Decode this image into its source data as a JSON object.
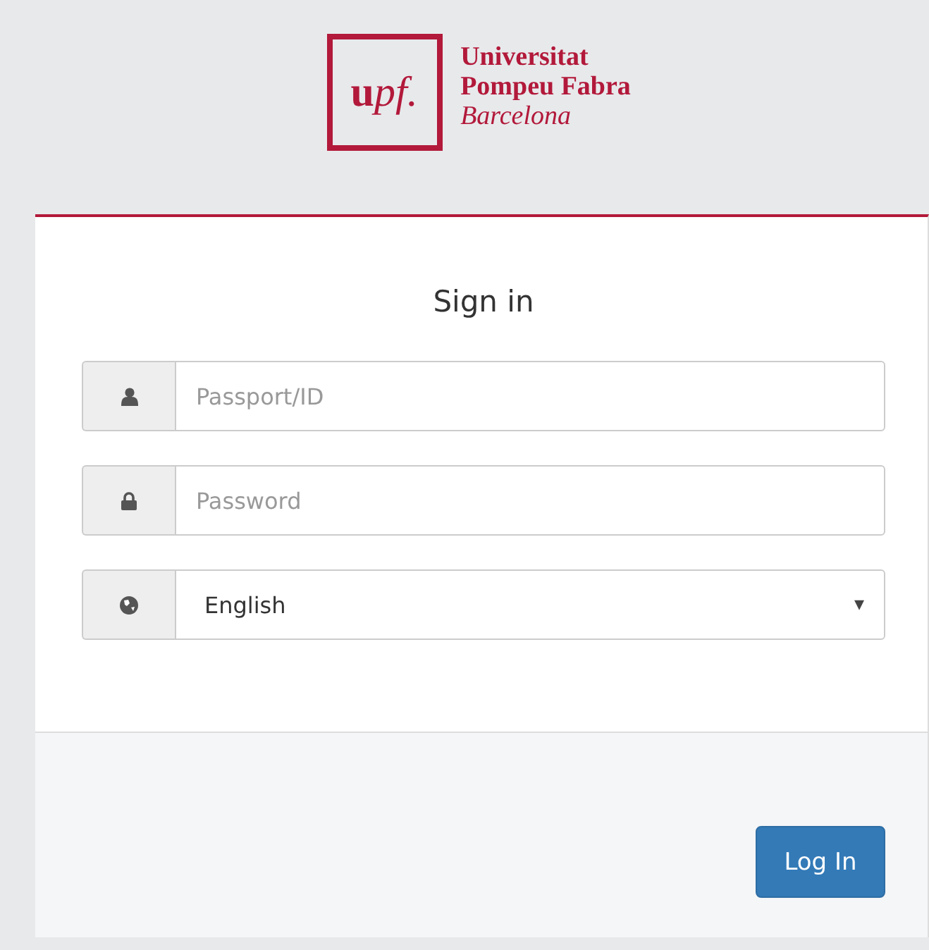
{
  "logo": {
    "mark": "upf.",
    "lines": [
      "Universitat",
      "Pompeu Fabra",
      "Barcelona"
    ]
  },
  "title": "Sign in",
  "fields": [
    {
      "kind": "text",
      "placeholder": "Passport/ID"
    },
    {
      "kind": "password",
      "placeholder": "Password"
    },
    {
      "kind": "select",
      "value": "English",
      "caret": "▾"
    }
  ],
  "button": "Log In"
}
